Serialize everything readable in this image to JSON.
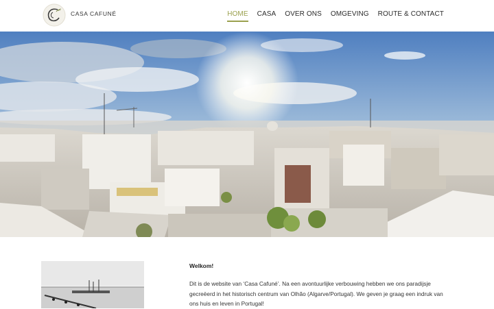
{
  "brand": {
    "name": "CASA CAFUNÉ",
    "logo_icon": "script-c-monogram-icon"
  },
  "nav": {
    "items": [
      {
        "label": "HOME",
        "active": true
      },
      {
        "label": "CASA",
        "active": false
      },
      {
        "label": "OVER ONS",
        "active": false
      },
      {
        "label": "OMGEVING",
        "active": false
      },
      {
        "label": "ROUTE & CONTACT",
        "active": false
      }
    ]
  },
  "colors": {
    "accent": "#9aa04d",
    "text": "#222222",
    "background": "#ffffff"
  },
  "content": {
    "title": "Welkom!",
    "body": "Dit is de website van ‘Casa Cafuné’. Na een avontuurlijke verbouwing hebben we ons paradijsje gecreëerd in het historisch centrum van Olhão (Algarve/Portugal). We geven je graag een indruk van ons huis en leven in Portugal!"
  }
}
